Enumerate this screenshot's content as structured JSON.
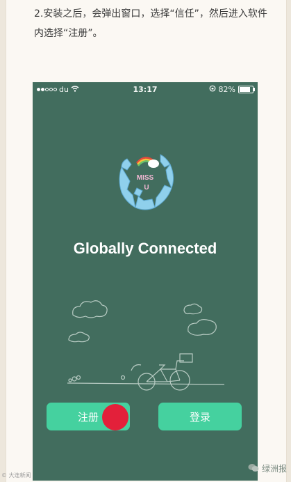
{
  "instruction": {
    "text": "2.安装之后，会弹出窗口，选择“信任”，然后进入软件内选择“注册”。"
  },
  "statusbar": {
    "carrier": "du",
    "time": "13:17",
    "battery_percent": "82%"
  },
  "app": {
    "logo_text_top": "MISS",
    "logo_text_bottom": "U",
    "tagline": "Globally Connected",
    "register_label": "注册",
    "login_label": "登录"
  },
  "watermark": {
    "left": "© 大连新闻",
    "right": "绿洲报"
  },
  "colors": {
    "phone_bg": "#426d5e",
    "button": "#45d19f",
    "tap_marker": "#e3203a",
    "page_bg": "#fbf8f3"
  }
}
